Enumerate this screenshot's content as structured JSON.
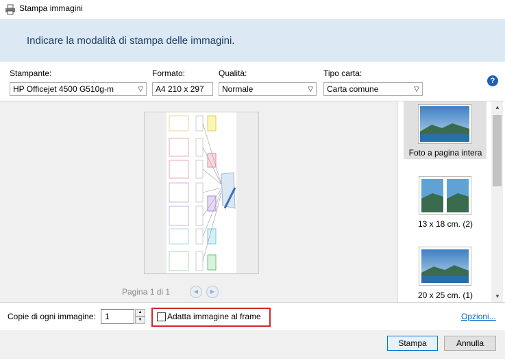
{
  "window": {
    "title": "Stampa immagini"
  },
  "banner": {
    "heading": "Indicare la modalità di stampa delle immagini."
  },
  "printer": {
    "label": "Stampante:",
    "value": "HP Officejet 4500 G510g-m"
  },
  "format": {
    "label": "Formato:",
    "value": "A4 210 x 297"
  },
  "quality": {
    "label": "Qualità:",
    "value": "Normale"
  },
  "paper_type": {
    "label": "Tipo carta:",
    "value": "Carta comune"
  },
  "preview": {
    "pager": "Pagina 1 di 1"
  },
  "layouts": [
    {
      "caption": "Foto a pagina intera",
      "selected": true
    },
    {
      "caption": "13 x 18 cm. (2)",
      "selected": false
    },
    {
      "caption": "20 x 25 cm. (1)",
      "selected": false
    }
  ],
  "copies": {
    "label": "Copie di ogni immagine:",
    "value": "1"
  },
  "fit_frame": {
    "label": "Adatta immagine al frame",
    "checked": false
  },
  "options_link": "Opzioni...",
  "buttons": {
    "print": "Stampa",
    "cancel": "Annulla"
  },
  "colors": {
    "banner_bg": "#dce9f5",
    "heading": "#1e3a66",
    "highlight_box": "#d0262f",
    "primary_border": "#0078d7"
  }
}
